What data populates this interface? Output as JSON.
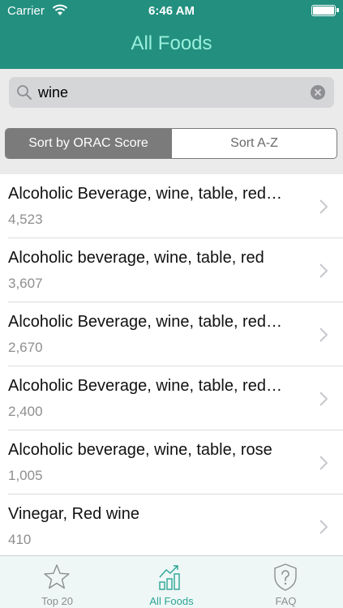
{
  "status_bar": {
    "carrier": "Carrier",
    "time": "6:46 AM"
  },
  "nav": {
    "title": "All Foods"
  },
  "search": {
    "value": "wine"
  },
  "sort": {
    "options": [
      "Sort by ORAC Score",
      "Sort A-Z"
    ],
    "selected": "Sort by ORAC Score"
  },
  "foods": [
    {
      "name": "Alcoholic Beverage, wine, table, red…",
      "score": "4,523"
    },
    {
      "name": "Alcoholic beverage, wine, table, red",
      "score": "3,607"
    },
    {
      "name": "Alcoholic Beverage, wine, table, red…",
      "score": "2,670"
    },
    {
      "name": "Alcoholic Beverage, wine, table, red…",
      "score": "2,400"
    },
    {
      "name": "Alcoholic beverage, wine, table, rose",
      "score": "1,005"
    },
    {
      "name": "Vinegar, Red wine",
      "score": "410"
    }
  ],
  "tabs": [
    {
      "label": "Top 20",
      "icon": "star-icon"
    },
    {
      "label": "All Foods",
      "icon": "bar-chart-icon",
      "selected": true
    },
    {
      "label": "FAQ",
      "icon": "question-shield-icon"
    }
  ],
  "colors": {
    "nav_bar": "#238f7f",
    "nav_title": "#98f0dc",
    "tab_selected": "#2aa594",
    "segment_active": "#7b7b7b"
  }
}
